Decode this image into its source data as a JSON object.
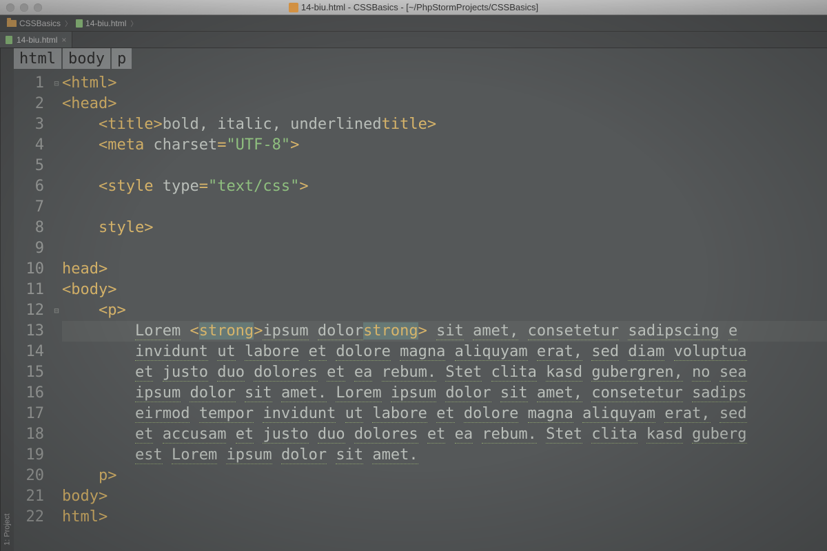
{
  "window_title": "14-biu.html - CSSBasics - [~/PhpStormProjects/CSSBasics]",
  "nav": {
    "project_name": "CSSBasics",
    "file_name": "14-biu.html"
  },
  "tab": {
    "file_name": "14-biu.html"
  },
  "tool_rail": {
    "project_label": "1: Project"
  },
  "crumbs": [
    "html",
    "body",
    "p"
  ],
  "code": {
    "indent": "    ",
    "punct": {
      "lt": "<",
      "gt": ">",
      "lts": "</",
      "eq": "=",
      "q": "\""
    },
    "tags": {
      "html": "html",
      "head": "head",
      "title": "title",
      "meta": "meta",
      "style": "style",
      "body": "body",
      "p": "p",
      "strong": "strong"
    },
    "attrs": {
      "charset": "charset",
      "type": "type"
    },
    "vals": {
      "utf8": "UTF-8",
      "textcss": "text/css"
    },
    "title_text": "bold, italic, underlined",
    "p_prefix": "Lorem ",
    "p_strong": "ipsum dolor",
    "p_after_strong": " sit amet, consetetur sadipscing e",
    "p_lines": [
      "invidunt ut labore et dolore magna aliquyam erat, sed diam voluptua",
      "et justo duo dolores et ea rebum. Stet clita kasd gubergren, no sea",
      "ipsum dolor sit amet. Lorem ipsum dolor sit amet, consetetur sadips",
      "eirmod tempor invidunt ut labore et dolore magna aliquyam erat, sed",
      "et accusam et justo duo dolores et ea rebum. Stet clita kasd guberg",
      "est Lorem ipsum dolor sit amet."
    ]
  },
  "line_numbers": [
    "1",
    "2",
    "3",
    "4",
    "5",
    "6",
    "7",
    "8",
    "9",
    "10",
    "11",
    "12",
    "13",
    "14",
    "15",
    "16",
    "17",
    "18",
    "19",
    "20",
    "21",
    "22"
  ]
}
